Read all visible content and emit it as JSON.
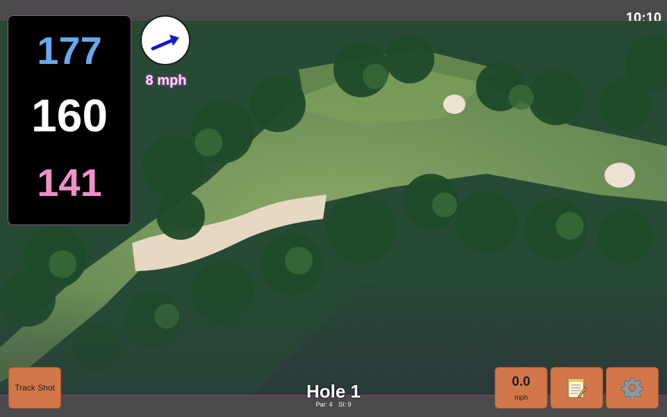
{
  "status": {
    "time": "10:10"
  },
  "distances": {
    "back": "177",
    "center": "160",
    "front": "141"
  },
  "wind": {
    "speed_label": "8 mph"
  },
  "hole": {
    "title": "Hole 1",
    "par_label": "Par: 4",
    "si_label": "SI: 9"
  },
  "buttons": {
    "track_shot": "Track Shot",
    "speed_value": "0.0",
    "speed_unit": "mph"
  },
  "icons": {
    "wind": "arrow-icon",
    "notes": "notepad-icon",
    "settings": "gear-icon"
  },
  "colors": {
    "button": "#d2774a",
    "back_distance": "#69a8f0",
    "center_distance": "#ffffff",
    "front_distance": "#f08fc8",
    "wind_arrow": "#1515d8"
  }
}
